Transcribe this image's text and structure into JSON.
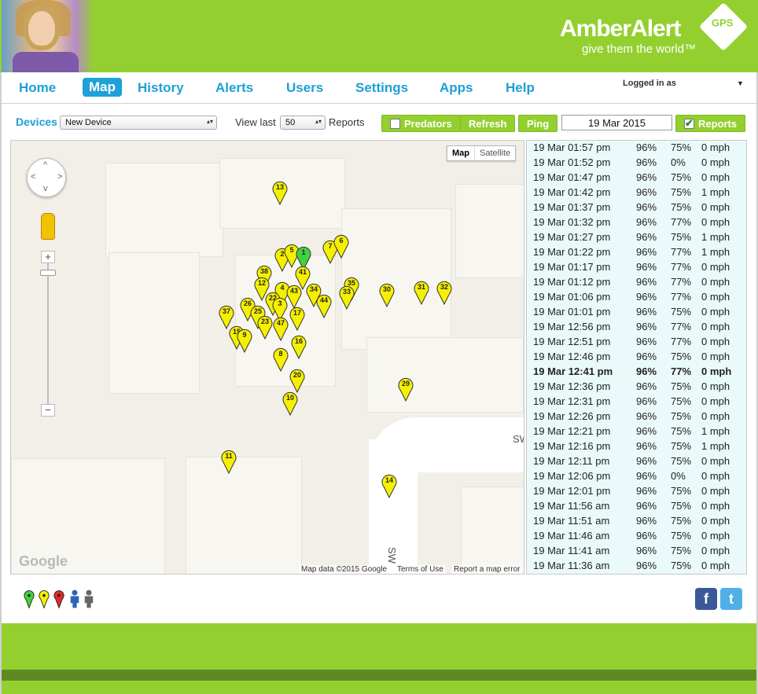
{
  "header": {
    "brand": "AmberAlert",
    "brand_badge": "GPS",
    "tagline": "give them the world™"
  },
  "nav": {
    "items": [
      {
        "label": "Home"
      },
      {
        "label": "Map"
      },
      {
        "label": "History"
      },
      {
        "label": "Alerts"
      },
      {
        "label": "Users"
      },
      {
        "label": "Settings"
      },
      {
        "label": "Apps"
      },
      {
        "label": "Help"
      }
    ],
    "active": "Map",
    "logged_in": "Logged in as"
  },
  "toolbar": {
    "devices_label": "Devices",
    "device_selected": "New Device",
    "view_last_label": "View last",
    "view_last_value": "50",
    "reports_label": "Reports",
    "predators_label": "Predators",
    "refresh_label": "Refresh",
    "ping_label": "Ping",
    "date": "19 Mar 2015",
    "reports_toggle_label": "Reports",
    "reports_checked": true,
    "predators_checked": false
  },
  "map": {
    "type_map": "Map",
    "type_satellite": "Satellite",
    "google_logo": "Google",
    "map_data": "Map data ©2015 Google",
    "terms": "Terms of Use",
    "report_error": "Report a map error",
    "street_label_1": "SW",
    "street_label_2": "SW",
    "pins": [
      {
        "n": "13"
      },
      {
        "n": "2"
      },
      {
        "n": "5"
      },
      {
        "n": "1"
      },
      {
        "n": "41"
      },
      {
        "n": "7"
      },
      {
        "n": "6"
      },
      {
        "n": "38"
      },
      {
        "n": "12"
      },
      {
        "n": "4"
      },
      {
        "n": "43"
      },
      {
        "n": "34"
      },
      {
        "n": "35"
      },
      {
        "n": "33"
      },
      {
        "n": "44"
      },
      {
        "n": "30"
      },
      {
        "n": "31"
      },
      {
        "n": "32"
      },
      {
        "n": "26"
      },
      {
        "n": "22"
      },
      {
        "n": "3"
      },
      {
        "n": "25"
      },
      {
        "n": "37"
      },
      {
        "n": "23"
      },
      {
        "n": "47"
      },
      {
        "n": "17"
      },
      {
        "n": "15"
      },
      {
        "n": "9"
      },
      {
        "n": "16"
      },
      {
        "n": "8"
      },
      {
        "n": "20"
      },
      {
        "n": "10"
      },
      {
        "n": "29"
      },
      {
        "n": "11"
      },
      {
        "n": "14"
      }
    ],
    "colors": {
      "pin_yellow": "#f5f000",
      "pin_green": "#3fd13f"
    }
  },
  "reports": [
    {
      "time": "19 Mar 01:57 pm",
      "battery": "96%",
      "signal": "75%",
      "speed": "0 mph"
    },
    {
      "time": "19 Mar 01:52 pm",
      "battery": "96%",
      "signal": "0%",
      "speed": "0 mph"
    },
    {
      "time": "19 Mar 01:47 pm",
      "battery": "96%",
      "signal": "75%",
      "speed": "0 mph"
    },
    {
      "time": "19 Mar 01:42 pm",
      "battery": "96%",
      "signal": "75%",
      "speed": "1 mph"
    },
    {
      "time": "19 Mar 01:37 pm",
      "battery": "96%",
      "signal": "75%",
      "speed": "0 mph"
    },
    {
      "time": "19 Mar 01:32 pm",
      "battery": "96%",
      "signal": "77%",
      "speed": "0 mph"
    },
    {
      "time": "19 Mar 01:27 pm",
      "battery": "96%",
      "signal": "75%",
      "speed": "1 mph"
    },
    {
      "time": "19 Mar 01:22 pm",
      "battery": "96%",
      "signal": "77%",
      "speed": "1 mph"
    },
    {
      "time": "19 Mar 01:17 pm",
      "battery": "96%",
      "signal": "77%",
      "speed": "0 mph"
    },
    {
      "time": "19 Mar 01:12 pm",
      "battery": "96%",
      "signal": "77%",
      "speed": "0 mph"
    },
    {
      "time": "19 Mar 01:06 pm",
      "battery": "96%",
      "signal": "77%",
      "speed": "0 mph"
    },
    {
      "time": "19 Mar 01:01 pm",
      "battery": "96%",
      "signal": "75%",
      "speed": "0 mph"
    },
    {
      "time": "19 Mar 12:56 pm",
      "battery": "96%",
      "signal": "77%",
      "speed": "0 mph"
    },
    {
      "time": "19 Mar 12:51 pm",
      "battery": "96%",
      "signal": "77%",
      "speed": "0 mph"
    },
    {
      "time": "19 Mar 12:46 pm",
      "battery": "96%",
      "signal": "75%",
      "speed": "0 mph"
    },
    {
      "time": "19 Mar 12:41 pm",
      "battery": "96%",
      "signal": "77%",
      "speed": "0 mph",
      "bold": true
    },
    {
      "time": "19 Mar 12:36 pm",
      "battery": "96%",
      "signal": "75%",
      "speed": "0 mph"
    },
    {
      "time": "19 Mar 12:31 pm",
      "battery": "96%",
      "signal": "75%",
      "speed": "0 mph"
    },
    {
      "time": "19 Mar 12:26 pm",
      "battery": "96%",
      "signal": "75%",
      "speed": "0 mph"
    },
    {
      "time": "19 Mar 12:21 pm",
      "battery": "96%",
      "signal": "75%",
      "speed": "1 mph"
    },
    {
      "time": "19 Mar 12:16 pm",
      "battery": "96%",
      "signal": "75%",
      "speed": "1 mph"
    },
    {
      "time": "19 Mar 12:11 pm",
      "battery": "96%",
      "signal": "75%",
      "speed": "0 mph"
    },
    {
      "time": "19 Mar 12:06 pm",
      "battery": "96%",
      "signal": "0%",
      "speed": "0 mph"
    },
    {
      "time": "19 Mar 12:01 pm",
      "battery": "96%",
      "signal": "75%",
      "speed": "0 mph"
    },
    {
      "time": "19 Mar 11:56 am",
      "battery": "96%",
      "signal": "75%",
      "speed": "0 mph"
    },
    {
      "time": "19 Mar 11:51 am",
      "battery": "96%",
      "signal": "75%",
      "speed": "0 mph"
    },
    {
      "time": "19 Mar 11:46 am",
      "battery": "96%",
      "signal": "75%",
      "speed": "0 mph"
    },
    {
      "time": "19 Mar 11:41 am",
      "battery": "96%",
      "signal": "75%",
      "speed": "0 mph"
    },
    {
      "time": "19 Mar 11:36 am",
      "battery": "96%",
      "signal": "75%",
      "speed": "0 mph"
    }
  ],
  "legend_icons": [
    {
      "icon": "green-pin-icon"
    },
    {
      "icon": "yellow-pin-icon"
    },
    {
      "icon": "red-pin-icon"
    },
    {
      "icon": "blue-person-icon"
    },
    {
      "icon": "gray-person-icon"
    }
  ],
  "social": {
    "facebook": "f",
    "twitter": "t"
  },
  "theme": {
    "brand_green": "#93d02f",
    "nav_blue": "#1e9fd6",
    "footer_band": "#5e8a22"
  }
}
